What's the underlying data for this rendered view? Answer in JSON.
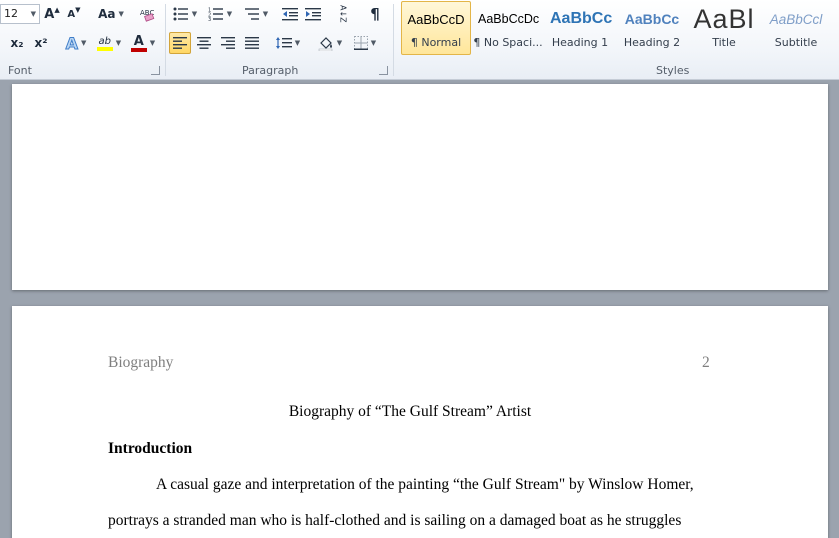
{
  "ribbon": {
    "font_group": {
      "label": "Font",
      "font_size": "12",
      "grow_font": "A",
      "shrink_font": "A",
      "change_case": "Aa",
      "subscript": "x₂",
      "superscript": "x²",
      "text_effects": "A",
      "highlight": "ab",
      "font_color": "A",
      "highlight_color": "#ffff00",
      "font_color_value": "#c00000"
    },
    "paragraph_group": {
      "label": "Paragraph",
      "pilcrow": "¶",
      "sort": "A↓Z"
    },
    "styles_group": {
      "label": "Styles",
      "items": [
        {
          "sample": "AaBbCcD",
          "name": "¶ Normal",
          "active": true
        },
        {
          "sample": "AaBbCcDc",
          "name": "¶ No Spaci..."
        },
        {
          "sample": "AaBbCc",
          "name": "Heading 1"
        },
        {
          "sample": "AaBbCc",
          "name": "Heading 2"
        },
        {
          "sample": "AaBl",
          "name": "Title"
        },
        {
          "sample": "AaBbCcl",
          "name": "Subtitle"
        }
      ]
    }
  },
  "document": {
    "header_left": "Biography",
    "header_page_number": "2",
    "title": "Biography of “The Gulf Stream” Artist",
    "heading": "Introduction",
    "paragraph_lines": [
      "A casual gaze and interpretation of the painting “the Gulf Stream\" by Winslow Homer,",
      "portrays a stranded man who is half-clothed and is sailing on a damaged boat as he struggles"
    ]
  },
  "colors": {
    "ribbon_accent": "#ffd764",
    "heading1_color": "#2e74b5",
    "heading2_color": "#4f81bd",
    "subtitle_color": "#7f9ec8"
  }
}
